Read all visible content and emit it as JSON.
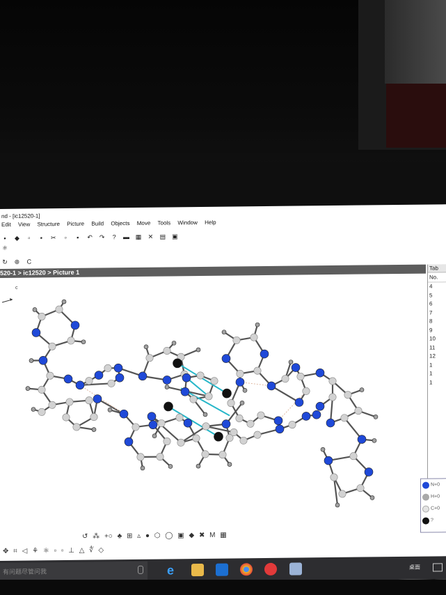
{
  "window": {
    "title": "nd - [ic12520-1]",
    "menu": [
      "Edit",
      "View",
      "Structure",
      "Picture",
      "Build",
      "Objects",
      "Move",
      "Tools",
      "Window",
      "Help"
    ]
  },
  "breadcrumb": "520-1 > ic12520 > Picture 1",
  "canvas": {
    "axis_label": "c"
  },
  "table_panel": {
    "title": "Tab",
    "header": "No.",
    "rows": [
      "4",
      "5",
      "6",
      "7",
      "8",
      "9",
      "10",
      "11",
      "12",
      "1",
      "1",
      "1"
    ]
  },
  "legend": {
    "items": [
      {
        "label": "N+0",
        "color": "#1f49d8"
      },
      {
        "label": "H+0",
        "color": "#a9a9a9"
      },
      {
        "label": "C+0",
        "color": "#e4e4e4"
      },
      {
        "label": "?",
        "color": "#111111"
      }
    ]
  },
  "colors": {
    "nitrogen": "#1f49d8",
    "carbon": "#d2d2d2",
    "hydrogen": "#a0a0a0",
    "metal": "#111111",
    "contact_line": "#27b7c9",
    "breadcrumb_bg": "#5d5d5d",
    "taskbar_bg": "#2d2d30"
  },
  "taskbar": {
    "search_placeholder": "有问题尽管问我",
    "tray_text": "桌面"
  }
}
